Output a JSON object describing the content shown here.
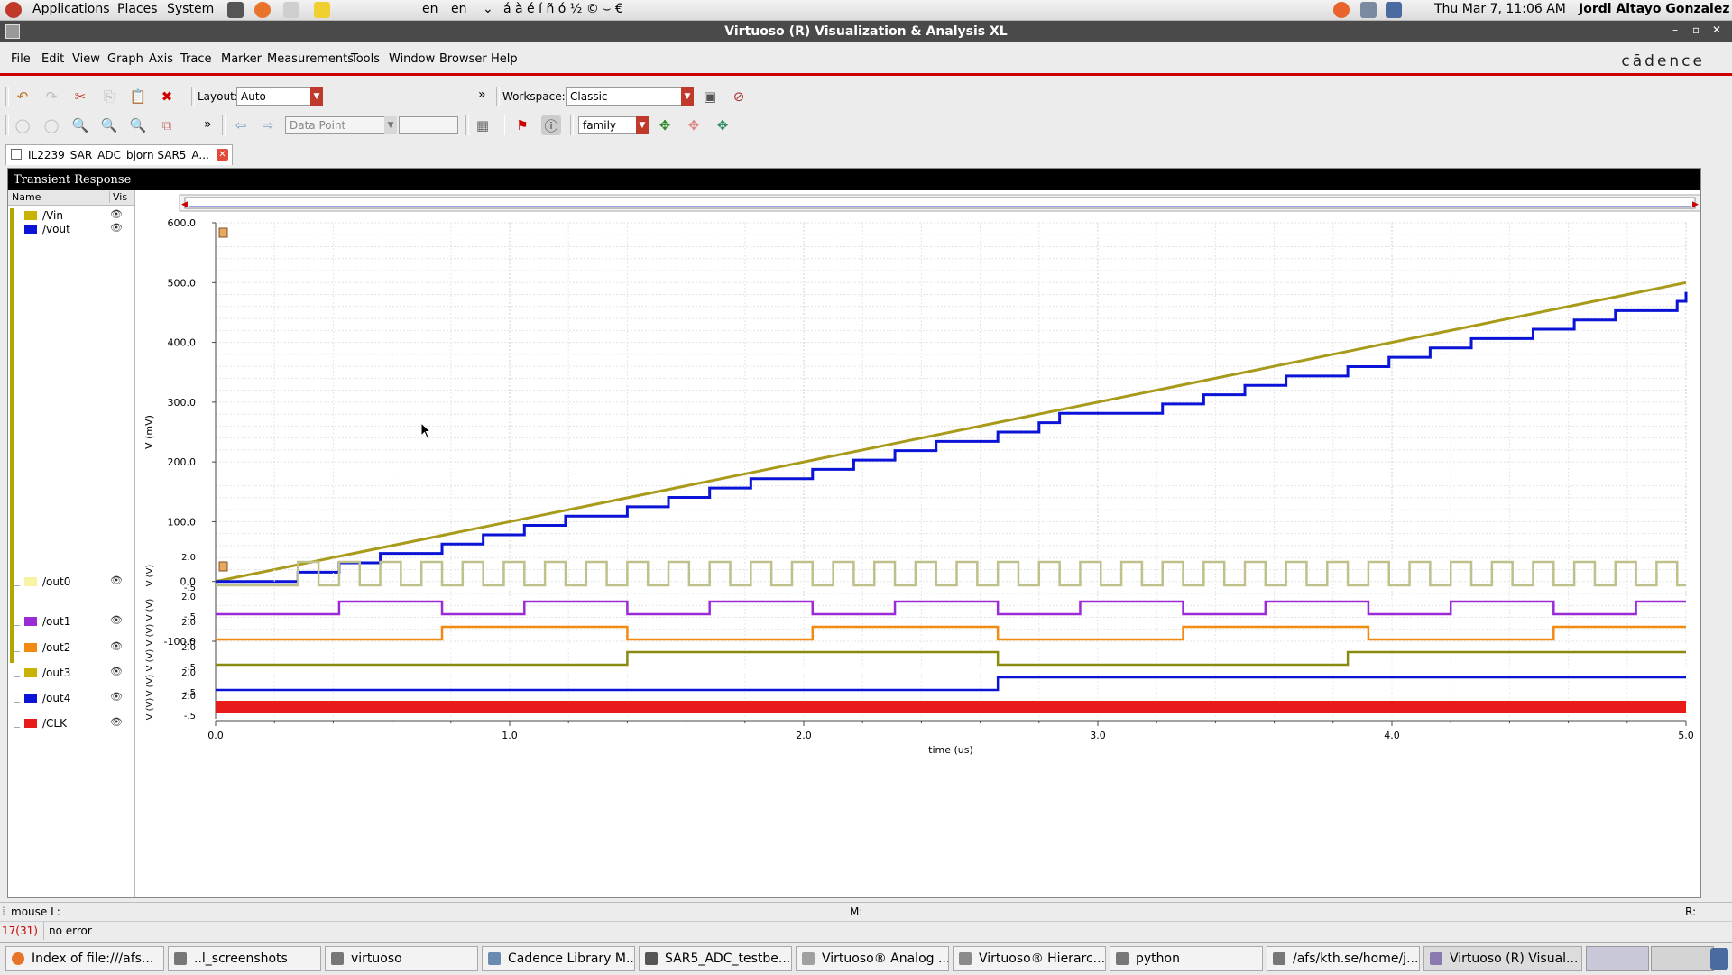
{
  "top_panel": {
    "menus": [
      "Applications",
      "Places",
      "System"
    ],
    "lang1": "en",
    "lang2": "en",
    "chars": "á à é í ñ ó ½ © ⌣ €",
    "datetime": "Thu Mar 7, 11:06 AM",
    "user": "Jordi Altayo Gonzalez"
  },
  "window": {
    "title": "Virtuoso (R) Visualization & Analysis XL",
    "controls": [
      "–",
      "▫",
      "✕"
    ]
  },
  "menubar": {
    "items": [
      "File",
      "Edit",
      "View",
      "Graph",
      "Axis",
      "Trace",
      "Marker",
      "Measurements",
      "Tools",
      "Window",
      "Browser",
      "Help"
    ],
    "brand": "cādence"
  },
  "toolbar1": {
    "layout_label": "Layout:",
    "layout_value": "Auto",
    "workspace_label": "Workspace:",
    "workspace_value": "Classic",
    "more": "»"
  },
  "toolbar2": {
    "data_point_value": "Data Point",
    "family_value": "family",
    "more": "»"
  },
  "tab": {
    "label": "IL2239_SAR_ADC_bjorn SAR5_A..."
  },
  "graph": {
    "title": "Transient Response",
    "legend_headers": [
      "Name",
      "Vis"
    ],
    "traces": [
      {
        "name": "/Vin",
        "color": "#c8b400"
      },
      {
        "name": "/vout",
        "color": "#0b14d6"
      },
      {
        "name": "/out0",
        "color": "#f8f3a4"
      },
      {
        "name": "/out1",
        "color": "#9b2bd6"
      },
      {
        "name": "/out2",
        "color": "#f28a12"
      },
      {
        "name": "/out3",
        "color": "#c8b400"
      },
      {
        "name": "/out4",
        "color": "#0b14d6"
      },
      {
        "name": "/CLK",
        "color": "#e81a1a"
      }
    ],
    "eye_icon": "👁",
    "main_ylabel": "V (mV)",
    "main_yticks": [
      "600.0",
      "500.0",
      "400.0",
      "300.0",
      "200.0",
      "100.0",
      "0.0",
      "-100.0"
    ],
    "sub_ylabel": "V (V)",
    "sub_yticks": [
      "2.0",
      "-.5"
    ],
    "xlabel": "time (us)",
    "xticks": [
      "0.0",
      "1.0",
      "2.0",
      "3.0",
      "4.0",
      "5.0"
    ]
  },
  "chart_data": {
    "type": "line",
    "title": "Transient Response",
    "xlabel": "time (us)",
    "ylabel": "V (mV)",
    "xlim": [
      0,
      5
    ],
    "ylim": [
      -100,
      600
    ],
    "series": [
      {
        "name": "/Vin",
        "x": [
          0,
          5
        ],
        "values": [
          0,
          500
        ]
      },
      {
        "name": "/vout",
        "x": [
          0,
          0.28,
          0.42,
          0.56,
          0.77,
          0.91,
          1.05,
          1.19,
          1.4,
          1.54,
          1.68,
          1.82,
          2.03,
          2.17,
          2.31,
          2.45,
          2.66,
          2.8,
          2.87,
          3.22,
          3.36,
          3.5,
          3.64,
          3.85,
          3.99,
          4.13,
          4.27,
          4.48,
          4.62,
          4.76,
          4.97,
          5.0
        ],
        "values": [
          0,
          15.6,
          31.3,
          46.9,
          62.5,
          78.1,
          93.8,
          109.4,
          125,
          140.6,
          156.3,
          171.9,
          187.5,
          203.1,
          218.8,
          234.4,
          250,
          265.6,
          281.3,
          296.9,
          312.5,
          328.1,
          343.8,
          359.4,
          375,
          390.6,
          406.3,
          421.9,
          437.5,
          453.1,
          468.8,
          484.4
        ]
      }
    ]
  },
  "status": {
    "left": "mouse L:",
    "mid": "M:",
    "right": "R:",
    "code": "17(31)",
    "msg": "no error"
  },
  "taskbar": {
    "items": [
      "Index of file:///afs...",
      "..l_screenshots",
      "virtuoso",
      "Cadence Library M...",
      "SAR5_ADC_testbe...",
      "Virtuoso® Analog ...",
      "Virtuoso® Hierarc...",
      "python",
      "/afs/kth.se/home/j...",
      "Virtuoso (R) Visual..."
    ]
  }
}
